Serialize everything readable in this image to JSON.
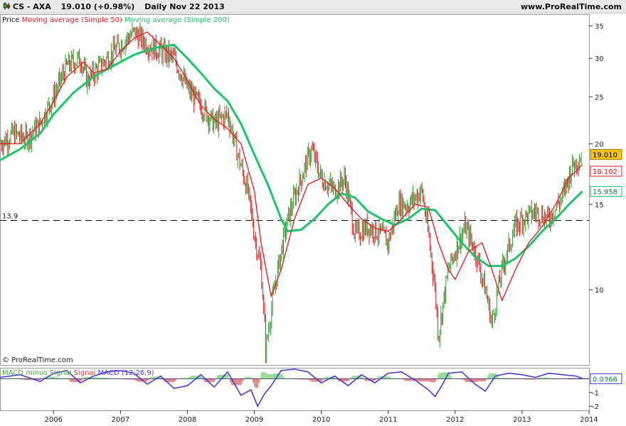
{
  "header": {
    "symbol": "CS - AXA",
    "quote": "19.010 (+0.98%)",
    "period": "Daily",
    "date": "Nov 22 2013",
    "site": "www.ProRealTime.com"
  },
  "colors": {
    "price": "#2e9f2e",
    "price_down": "#cc2222",
    "sma50": "#e31a1c",
    "sma200": "#1ec36b",
    "macd": "#4b3bd8",
    "hist_pos": "#7fd47f",
    "hist_neg": "#d97070",
    "threshold": "#000000"
  },
  "chart_data": [
    {
      "type": "line",
      "legend": [
        "Price",
        "Moving average (Simple 50)",
        "Moving average (Simple 200)"
      ],
      "x_ticks": [
        2006,
        2007,
        2008,
        2009,
        2010,
        2011,
        2012,
        2013,
        2014
      ],
      "y_scale": "log",
      "y_ticks": [
        10,
        15,
        20,
        25,
        30,
        35
      ],
      "ylim": [
        7,
        37
      ],
      "xlim": [
        2005.2,
        2014.0
      ],
      "threshold": {
        "value": 13.9,
        "label": "13.9"
      },
      "last_values": {
        "price": "19.010",
        "sma50": "18.102",
        "sma200": "15.958"
      },
      "watermark": "© ProRealTime.com",
      "series": [
        {
          "name": "Price",
          "x": [
            2005.2,
            2005.4,
            2005.6,
            2005.8,
            2006.0,
            2006.2,
            2006.4,
            2006.5,
            2006.7,
            2006.9,
            2007.0,
            2007.2,
            2007.3,
            2007.4,
            2007.6,
            2007.8,
            2008.0,
            2008.2,
            2008.4,
            2008.6,
            2008.75,
            2008.9,
            2009.0,
            2009.1,
            2009.17,
            2009.3,
            2009.5,
            2009.7,
            2009.85,
            2010.0,
            2010.2,
            2010.35,
            2010.5,
            2010.7,
            2010.9,
            2011.0,
            2011.15,
            2011.3,
            2011.5,
            2011.6,
            2011.7,
            2011.75,
            2011.9,
            2012.0,
            2012.15,
            2012.3,
            2012.45,
            2012.55,
            2012.7,
            2012.9,
            2013.0,
            2013.2,
            2013.4,
            2013.6,
            2013.75,
            2013.9
          ],
          "values": [
            20,
            21,
            20.5,
            22,
            25,
            29,
            30,
            27,
            29,
            31,
            32,
            34,
            33,
            32,
            31,
            30,
            26,
            24,
            22,
            23,
            19,
            16,
            13,
            11,
            7.5,
            10,
            14,
            17,
            19.5,
            17,
            16,
            17,
            13,
            13.5,
            13,
            12.5,
            15,
            15,
            16,
            13,
            10,
            8,
            11,
            12,
            13.5,
            12,
            10,
            8.5,
            11,
            13.5,
            14,
            14.5,
            14,
            15.5,
            18,
            19
          ]
        },
        {
          "name": "Moving average (Simple 50)",
          "x": [
            2005.2,
            2005.5,
            2005.8,
            2006.0,
            2006.2,
            2006.45,
            2006.6,
            2006.8,
            2007.0,
            2007.2,
            2007.4,
            2007.6,
            2007.8,
            2008.0,
            2008.2,
            2008.4,
            2008.6,
            2008.8,
            2009.0,
            2009.1,
            2009.25,
            2009.4,
            2009.6,
            2009.8,
            2010.0,
            2010.2,
            2010.4,
            2010.6,
            2010.8,
            2011.0,
            2011.2,
            2011.4,
            2011.6,
            2011.75,
            2011.9,
            2012.0,
            2012.2,
            2012.4,
            2012.55,
            2012.7,
            2012.9,
            2013.1,
            2013.3,
            2013.5,
            2013.7,
            2013.9
          ],
          "values": [
            20,
            20,
            22,
            24.5,
            27.5,
            29.5,
            28,
            28.5,
            31,
            33,
            34,
            32,
            30,
            27,
            24,
            22.5,
            21.5,
            20,
            16,
            12.5,
            9.7,
            11,
            14,
            16.5,
            17,
            16.2,
            15,
            14,
            13.4,
            13.2,
            14,
            15,
            14.8,
            12.5,
            11,
            10.5,
            12,
            12.5,
            11,
            9.5,
            11,
            12.5,
            13.5,
            15,
            17,
            18.1
          ]
        },
        {
          "name": "Moving average (Simple 200)",
          "x": [
            2005.2,
            2005.5,
            2005.8,
            2006.0,
            2006.3,
            2006.6,
            2006.9,
            2007.2,
            2007.5,
            2007.8,
            2008.0,
            2008.2,
            2008.4,
            2008.6,
            2008.8,
            2009.0,
            2009.2,
            2009.4,
            2009.5,
            2009.7,
            2009.9,
            2010.1,
            2010.3,
            2010.5,
            2010.7,
            2010.9,
            2011.1,
            2011.3,
            2011.5,
            2011.7,
            2011.9,
            2012.1,
            2012.3,
            2012.5,
            2012.7,
            2012.9,
            2013.1,
            2013.3,
            2013.5,
            2013.7,
            2013.9
          ],
          "values": [
            18.5,
            19.5,
            21,
            23,
            25.5,
            27.5,
            29,
            30.5,
            31.5,
            32,
            30,
            28,
            26,
            24.5,
            22,
            19,
            16.5,
            14,
            13.2,
            13.3,
            14,
            15,
            15.8,
            15.5,
            14.5,
            14,
            13.6,
            14,
            14.7,
            14.6,
            13.5,
            12.5,
            11.7,
            11.2,
            11.2,
            11.6,
            12.3,
            13.2,
            14,
            15,
            15.96
          ]
        }
      ]
    },
    {
      "type": "line",
      "legend": [
        "MACD minus Signal",
        "Signal",
        "MACD (12,26,9)"
      ],
      "y_ticks": [
        -1,
        -2
      ],
      "ylim": [
        -2.3,
        0.8
      ],
      "last_value": "0.0366",
      "series": [
        {
          "name": "MACD (12,26,9)",
          "x": [
            2005.2,
            2005.5,
            2005.8,
            2006.0,
            2006.2,
            2006.4,
            2006.6,
            2006.8,
            2007.0,
            2007.2,
            2007.4,
            2007.6,
            2007.8,
            2008.0,
            2008.2,
            2008.4,
            2008.6,
            2008.8,
            2008.95,
            2009.05,
            2009.15,
            2009.25,
            2009.4,
            2009.6,
            2009.8,
            2010.0,
            2010.2,
            2010.4,
            2010.6,
            2010.8,
            2011.0,
            2011.2,
            2011.4,
            2011.6,
            2011.7,
            2011.8,
            2011.9,
            2012.1,
            2012.3,
            2012.45,
            2012.6,
            2012.8,
            2013.0,
            2013.2,
            2013.4,
            2013.6,
            2013.8,
            2013.9
          ],
          "values": [
            0.1,
            0.3,
            -0.2,
            0.4,
            0.6,
            -0.3,
            0.2,
            0.5,
            0.6,
            0.4,
            -0.4,
            0.2,
            -0.7,
            -0.5,
            0.3,
            -0.6,
            0.5,
            -1.2,
            -0.8,
            -2.0,
            -1.1,
            -0.5,
            0.6,
            0.7,
            0.5,
            -0.3,
            0.2,
            -0.5,
            0.3,
            -0.3,
            0.4,
            0.5,
            -0.1,
            -0.8,
            -1.3,
            -0.5,
            0.4,
            0.5,
            -0.4,
            -0.9,
            0.2,
            0.4,
            0.3,
            0.1,
            0.4,
            0.3,
            0.2,
            0.04
          ]
        }
      ]
    }
  ]
}
